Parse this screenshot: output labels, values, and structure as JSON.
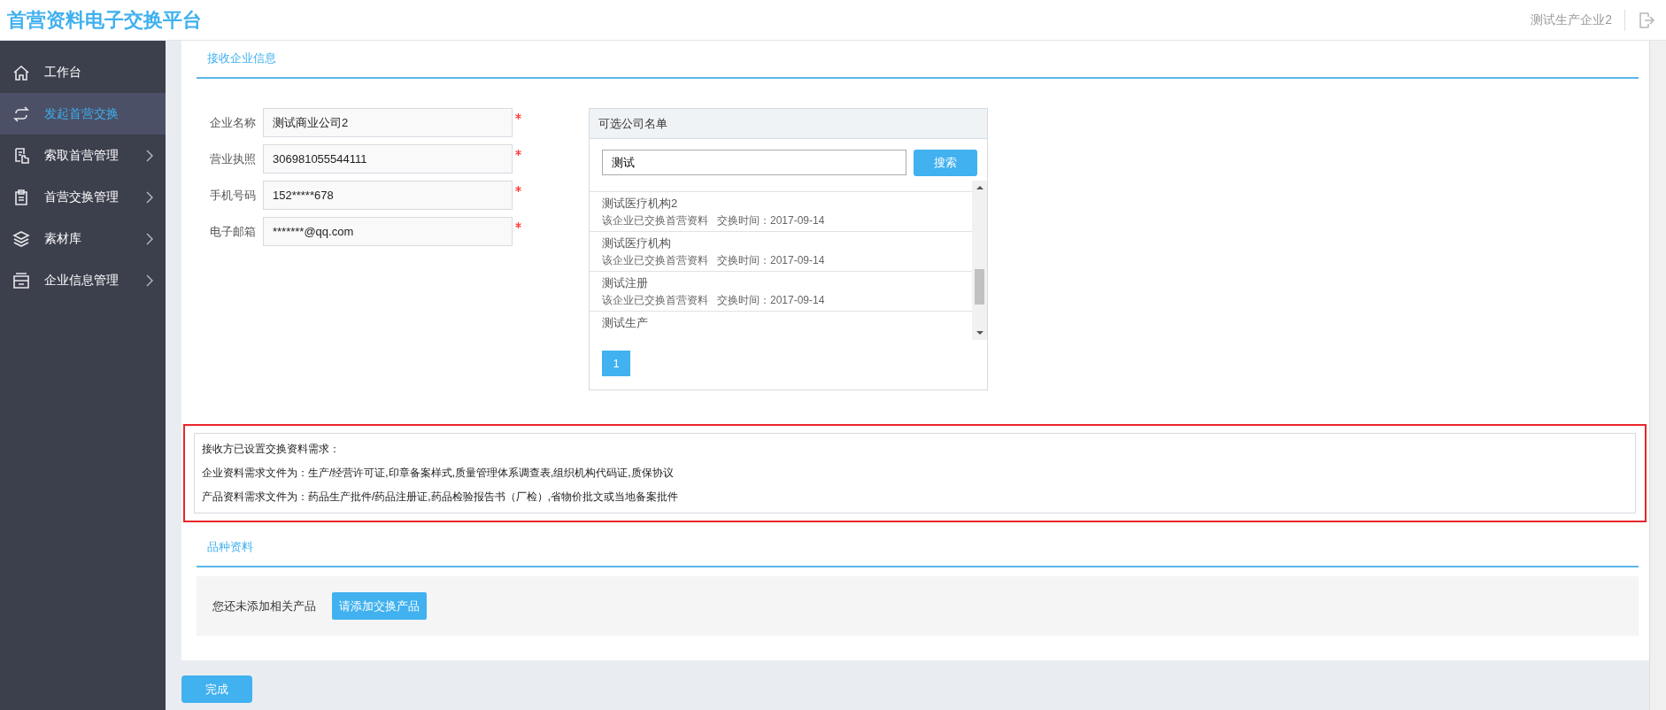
{
  "header": {
    "title": "首营资料电子交换平台",
    "user": "测试生产企业2"
  },
  "sidebar": {
    "items": [
      {
        "label": "工作台",
        "selected": false,
        "expandable": false
      },
      {
        "label": "发起首营交换",
        "selected": true,
        "expandable": false
      },
      {
        "label": "索取首营管理",
        "selected": false,
        "expandable": true
      },
      {
        "label": "首营交换管理",
        "selected": false,
        "expandable": true
      },
      {
        "label": "素材库",
        "selected": false,
        "expandable": true
      },
      {
        "label": "企业信息管理",
        "selected": false,
        "expandable": true
      }
    ]
  },
  "receiver_section": {
    "title": "接收企业信息",
    "fields": [
      {
        "label": "企业名称",
        "value": "测试商业公司2",
        "required": true
      },
      {
        "label": "营业执照",
        "value": "306981055544111",
        "required": true
      },
      {
        "label": "手机号码",
        "value": "152*****678",
        "required": true
      },
      {
        "label": "电子邮箱",
        "value": "*******@qq.com",
        "required": true
      }
    ],
    "company_list": {
      "title": "可选公司名单",
      "search": {
        "value": "测试"
      },
      "search_button": "搜索",
      "rows": [
        {
          "name": "测试医疗机构2",
          "meta": "该企业已交换首营资料",
          "time": "交换时间：2017-09-14"
        },
        {
          "name": "测试医疗机构",
          "meta": "该企业已交换首营资料",
          "time": "交换时间：2017-09-14"
        },
        {
          "name": "测试注册",
          "meta": "该企业已交换首营资料",
          "time": "交换时间：2017-09-14"
        },
        {
          "name": "测试生产"
        }
      ],
      "pages": [
        {
          "label": "1",
          "selected": true
        }
      ]
    }
  },
  "requirements": {
    "heading": "接收方已设置交换资料需求：",
    "lines": [
      "企业资料需求文件为：生产/经营许可证,印章备案样式,质量管理体系调查表,组织机构代码证,质保协议",
      "产品资料需求文件为：药品生产批件/药品注册证,药品检验报告书（厂检）,省物价批文或当地备案批件"
    ]
  },
  "product_section": {
    "title": "品种资料",
    "empty_text": "您还未添加相关产品",
    "add_button": "请添加交换产品"
  },
  "done_button": "完成"
}
